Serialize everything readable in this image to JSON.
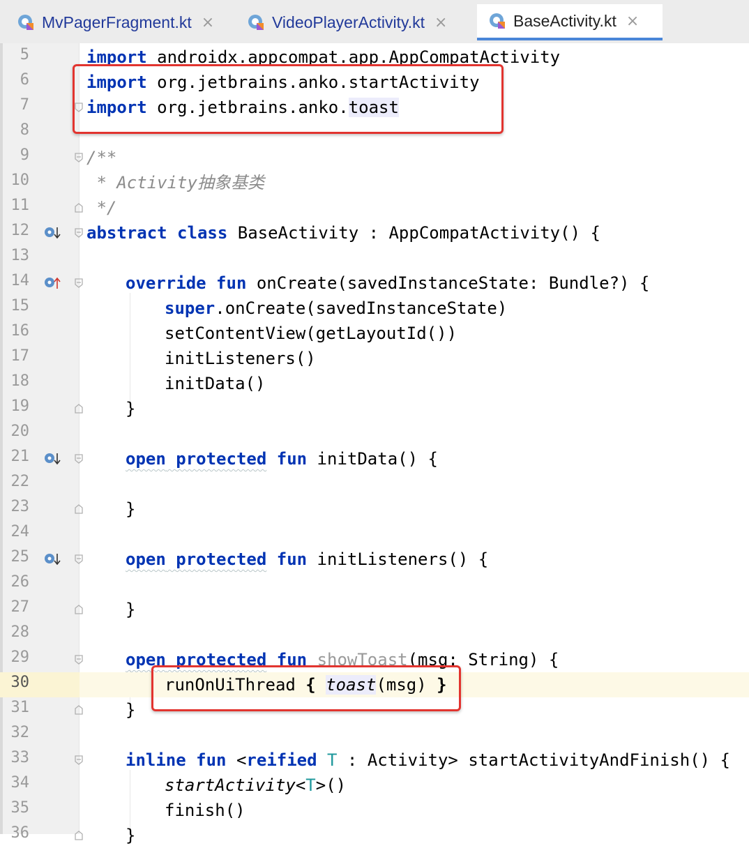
{
  "tabs": [
    {
      "label": "MvPagerFragment.kt",
      "active": false,
      "close": "×"
    },
    {
      "label": "VideoPlayerActivity.kt",
      "active": false,
      "close": "×"
    },
    {
      "label": "BaseActivity.kt",
      "active": true,
      "close": "×"
    }
  ],
  "editor": {
    "current_line": 30,
    "lines": [
      {
        "n": "5"
      },
      {
        "n": "6"
      },
      {
        "n": "7"
      },
      {
        "n": "8"
      },
      {
        "n": "9"
      },
      {
        "n": "10"
      },
      {
        "n": "11"
      },
      {
        "n": "12"
      },
      {
        "n": "13"
      },
      {
        "n": "14"
      },
      {
        "n": "15"
      },
      {
        "n": "16"
      },
      {
        "n": "17"
      },
      {
        "n": "18"
      },
      {
        "n": "19"
      },
      {
        "n": "20"
      },
      {
        "n": "21"
      },
      {
        "n": "22"
      },
      {
        "n": "23"
      },
      {
        "n": "24"
      },
      {
        "n": "25"
      },
      {
        "n": "26"
      },
      {
        "n": "27"
      },
      {
        "n": "28"
      },
      {
        "n": "29"
      },
      {
        "n": "30"
      },
      {
        "n": "31"
      },
      {
        "n": "32"
      },
      {
        "n": "33"
      },
      {
        "n": "34"
      },
      {
        "n": "35"
      },
      {
        "n": "36"
      }
    ],
    "code": {
      "l5": {
        "kw": "import",
        "rest": " androidx.appcompat.app.AppCompatActivity"
      },
      "l6": {
        "kw": "import",
        "rest": " org.jetbrains.anko.startActivity"
      },
      "l7": {
        "kw": "import",
        "rest": " org.jetbrains.anko.",
        "hl": "toast"
      },
      "l9": {
        "text": "/**"
      },
      "l10": {
        "text": " * Activity抽象基类"
      },
      "l11": {
        "text": " */"
      },
      "l12": {
        "kw1": "abstract",
        "kw2": "class",
        "rest": " BaseActivity : AppCompatActivity() {"
      },
      "l14": {
        "kw1": "override",
        "kw2": "fun",
        "rest": " onCreate(savedInstanceState: Bundle?) {"
      },
      "l15": {
        "kw": "super",
        "rest": ".onCreate(savedInstanceState)"
      },
      "l16": {
        "text": "setContentView(getLayoutId())"
      },
      "l17": {
        "text": "initListeners()"
      },
      "l18": {
        "text": "initData()"
      },
      "l19": {
        "text": "}"
      },
      "l21": {
        "kw1": "open",
        "kw2": "protected",
        "kw3": "fun",
        "rest": " initData() {"
      },
      "l23": {
        "text": "}"
      },
      "l25": {
        "kw1": "open",
        "kw2": "protected",
        "kw3": "fun",
        "rest": " initListeners() {"
      },
      "l27": {
        "text": "}"
      },
      "l29": {
        "kw1": "open",
        "kw2": "protected",
        "kw3": "fun",
        "fn": "showToast",
        "rest": "(msg: String) {"
      },
      "l30": {
        "pre": "runOnUiThread ",
        "brace_open": "{",
        "call": "toast",
        "args": "(msg) ",
        "brace_close": "}"
      },
      "l31": {
        "text": "}"
      },
      "l33": {
        "kw1": "inline",
        "kw2": "fun",
        "lt": " <",
        "kw3": "reified",
        "tp": "T",
        "rest": " : Activity> startActivityAndFinish() {"
      },
      "l34": {
        "call": "startActivity",
        "lt": "<",
        "tp": "T",
        "rest": ">()"
      },
      "l35": {
        "text": "finish()"
      },
      "l36": {
        "text": "}"
      }
    }
  },
  "colors": {
    "keyword": "#0033b3",
    "comment": "#8c8c8c",
    "type_param": "#20999d",
    "highlight_box": "#e2342f",
    "current_line": "#fdf9e6"
  },
  "icons": [
    "kotlin-file-icon",
    "implemented-down-icon",
    "overrides-up-icon",
    "fold-marker-icon"
  ]
}
